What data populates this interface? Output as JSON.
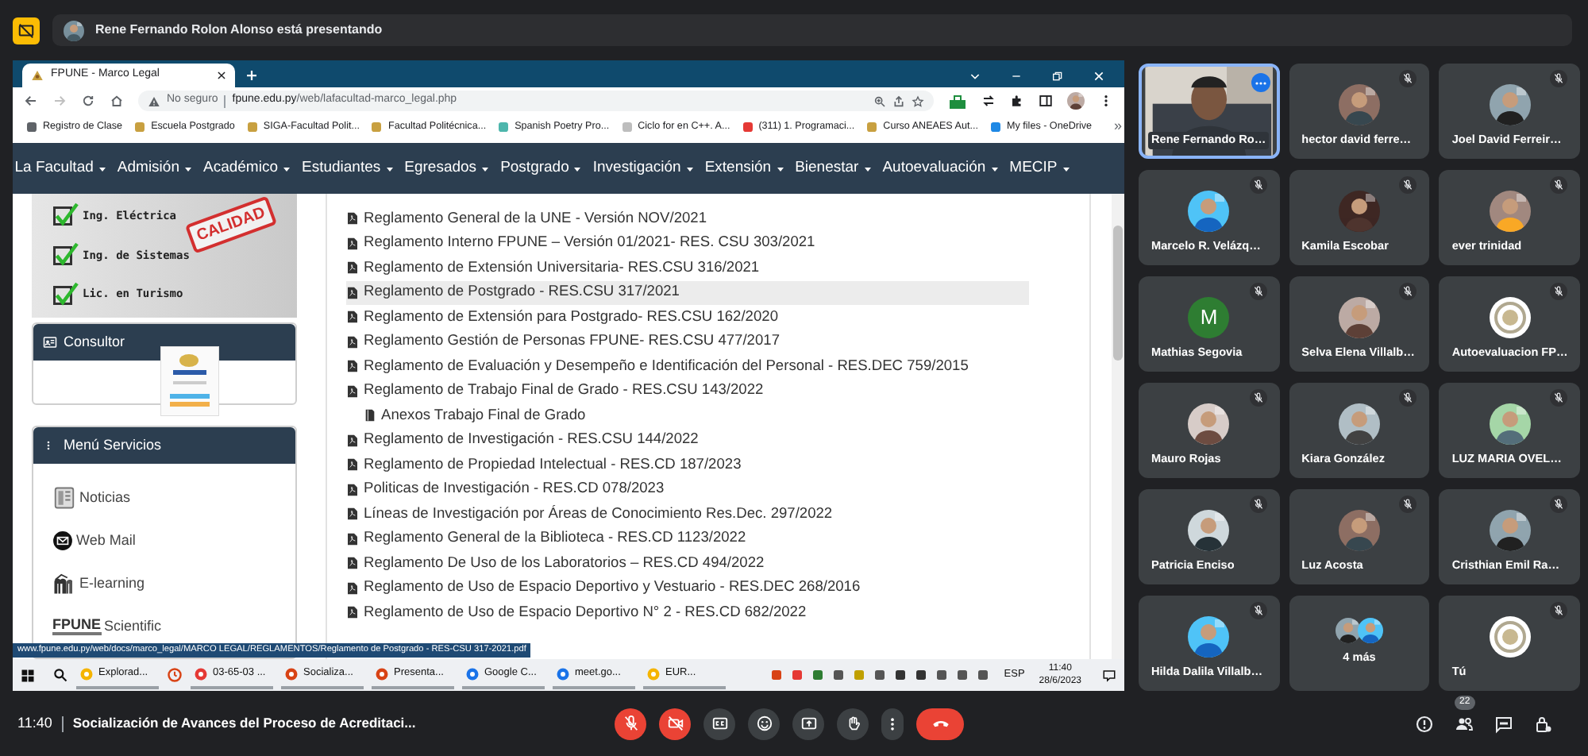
{
  "presenter_banner": {
    "text": "Rene Fernando Rolon Alonso está presentando"
  },
  "browser": {
    "tabs": [
      {
        "title": "FPUNE - Marco Legal",
        "selected": true
      }
    ],
    "address": {
      "security": "No seguro",
      "host": "fpune.edu.py",
      "path": "/web/lafacultad-marco_legal.php"
    },
    "bookmarks": [
      "Registro de Clase",
      "Escuela Postgrado",
      "SIGA-Facultad Polit...",
      "Facultad Politécnica...",
      "Spanish Poetry Pro...",
      "Ciclo for en C++. A...",
      "(311) 1. Programaci...",
      "Curso ANEAES Aut...",
      "My files - OneDrive"
    ],
    "bookmarks_overflow": "»",
    "nav_menu": [
      {
        "label": "La Facultad",
        "dropdown": true
      },
      {
        "label": "Admisión",
        "dropdown": true
      },
      {
        "label": "Académico",
        "dropdown": true
      },
      {
        "label": "Estudiantes",
        "dropdown": true
      },
      {
        "label": "Egresados",
        "dropdown": true
      },
      {
        "label": "Postgrado",
        "dropdown": true
      },
      {
        "label": "Investigación",
        "dropdown": true
      },
      {
        "label": "Extensión",
        "dropdown": true
      },
      {
        "label": "Bienestar",
        "dropdown": true
      },
      {
        "label": "Autoevaluación",
        "dropdown": true
      },
      {
        "label": "MECIP",
        "dropdown": true
      }
    ],
    "sidebar": {
      "banner": {
        "items": [
          "Ing. Eléctrica",
          "Ing. de Sistemas",
          "Lic. en Turismo"
        ],
        "stamp": "CALIDAD"
      },
      "consultor": {
        "title": "Consultor"
      },
      "services": {
        "title": "Menú Servicios",
        "items": [
          {
            "kind": "news",
            "label": "Noticias"
          },
          {
            "kind": "mail",
            "label": "Web Mail"
          },
          {
            "kind": "elearning",
            "label": "E-learning"
          },
          {
            "kind": "logo",
            "logo": "FPUNE",
            "label": "Scientific"
          }
        ]
      }
    },
    "documents": [
      {
        "title": "Reglamento General de la UNE - Versión NOV/2021",
        "hovered": false
      },
      {
        "title": "Reglamento Interno FPUNE – Versión 01/2021- RES. CSU 303/2021",
        "hovered": false
      },
      {
        "title": "Reglamento de Extensión Universitaria- RES.CSU 316/2021",
        "hovered": false
      },
      {
        "title": "Reglamento de Postgrado - RES.CSU 317/2021",
        "hovered": true
      },
      {
        "title": "Reglamento de Extensión para Postgrado- RES.CSU 162/2020",
        "hovered": false
      },
      {
        "title": "Reglamento Gestión de Personas FPUNE- RES.CSU 477/2017",
        "hovered": false
      },
      {
        "title": "Reglamento de Evaluación y Desempeño e Identificación del Personal - RES.DEC 759/2015",
        "hovered": false
      },
      {
        "title": "Reglamento de Trabajo Final de Grado - RES.CSU 143/2022",
        "hovered": false,
        "children": [
          {
            "title": "Anexos Trabajo Final de Grado",
            "hovered": false
          }
        ]
      },
      {
        "title": "Reglamento de Investigación - RES.CSU 144/2022",
        "hovered": false
      },
      {
        "title": "Reglamento de Propiedad Intelectual - RES.CD 187/2023",
        "hovered": false
      },
      {
        "title": "Politicas de Investigación - RES.CD 078/2023",
        "hovered": false
      },
      {
        "title": "Líneas de Investigación por Áreas de Conocimiento Res.Dec. 297/2022",
        "hovered": false
      },
      {
        "title": "Reglamento General de la Biblioteca - RES.CD 1123/2022",
        "hovered": false
      },
      {
        "title": "Reglamento De Uso de los Laboratorios – RES.CD 494/2022",
        "hovered": false
      },
      {
        "title": "Reglamento de Uso de Espacio Deportivo y Vestuario - RES.DEC 268/2016",
        "hovered": false
      },
      {
        "title": "Reglamento de Uso de Espacio Deportivo N° 2 - RES.CD 682/2022",
        "hovered": false
      }
    ],
    "status_url": "www.fpune.edu.py/web/docs/marco_legal/MARCO LEGAL/REGLAMENTOS/Reglamento de Postgrado - RES-CSU 317-2021.pdf",
    "taskbar": {
      "items": [
        {
          "kind": "window",
          "label": "Explorad..."
        },
        {
          "kind": "pinned"
        },
        {
          "kind": "window",
          "label": "03-65-03 ..."
        },
        {
          "kind": "window",
          "label": "Socializa..."
        },
        {
          "kind": "window",
          "label": "Presenta..."
        },
        {
          "kind": "window",
          "label": "Google C..."
        },
        {
          "kind": "window",
          "label": "meet.go..."
        },
        {
          "kind": "window",
          "label": "EUR..."
        }
      ],
      "language": "ESP",
      "time": "11:40",
      "date": "28/6/2023"
    }
  },
  "participants": [
    {
      "name": "Rene Fernando Ro…",
      "kind": "video",
      "muted": false,
      "highlighted": true
    },
    {
      "name": "hector david ferre…",
      "muted": true,
      "highlighted": false
    },
    {
      "name": "Joel David Ferreir…",
      "muted": true,
      "highlighted": false
    },
    {
      "name": "Marcelo R. Velázq…",
      "muted": true,
      "highlighted": false
    },
    {
      "name": "Kamila Escobar",
      "muted": true,
      "highlighted": false
    },
    {
      "name": "ever trinidad",
      "muted": true,
      "highlighted": false
    },
    {
      "name": "Mathias Segovia",
      "kind": "initial",
      "initial": "M",
      "color": "#2e7d32",
      "muted": true,
      "highlighted": false
    },
    {
      "name": "Selva Elena Villalb…",
      "muted": true,
      "highlighted": false
    },
    {
      "name": "Autoevaluacion FP…",
      "kind": "emblem",
      "muted": true,
      "highlighted": false
    },
    {
      "name": "Mauro Rojas",
      "muted": true,
      "highlighted": false
    },
    {
      "name": "Kiara González",
      "muted": true,
      "highlighted": false
    },
    {
      "name": "LUZ MARIA OVEL…",
      "muted": true,
      "highlighted": false
    },
    {
      "name": "Patricia Enciso",
      "muted": true,
      "highlighted": false
    },
    {
      "name": "Luz Acosta",
      "muted": true,
      "highlighted": false
    },
    {
      "name": "Cristhian Emil Ra…",
      "muted": true,
      "highlighted": false
    },
    {
      "name": "Hilda Dalila Villalb…",
      "muted": true,
      "highlighted": false
    },
    {
      "name": "4 más",
      "kind": "overflow",
      "muted": false,
      "highlighted": false
    },
    {
      "name": "Tú",
      "kind": "emblem",
      "muted": true,
      "highlighted": false
    }
  ],
  "meeting_bar": {
    "time": "11:40",
    "title": "Socialización de Avances del Proceso de Acreditaci...",
    "controls": [
      {
        "kind": "mic",
        "on": false
      },
      {
        "kind": "camera",
        "on": false
      },
      {
        "kind": "captions",
        "on": false
      },
      {
        "kind": "reactions"
      },
      {
        "kind": "present"
      },
      {
        "kind": "hand"
      },
      {
        "kind": "more"
      },
      {
        "kind": "leave"
      }
    ],
    "side_buttons": [
      {
        "kind": "info"
      },
      {
        "kind": "people",
        "badge": "22"
      },
      {
        "kind": "chat"
      },
      {
        "kind": "activities"
      }
    ]
  }
}
